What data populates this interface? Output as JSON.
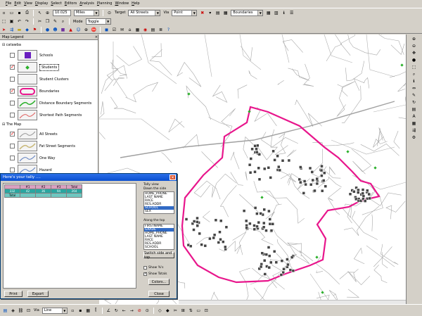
{
  "menu": [
    "File",
    "Edit",
    "View",
    "Display",
    "Select",
    "Editors",
    "Analysis",
    "Planning",
    "Window",
    "Help"
  ],
  "toolbar": {
    "scale_value": "10.025",
    "units": "Miles",
    "target_label": "Target",
    "target_value": "All Streets",
    "via_label": "Via",
    "via_value": "Point",
    "layer_value": "Boundaries",
    "mode_label": "Mode",
    "mode_value": "Toggle"
  },
  "legend": {
    "title": "Map Legend",
    "group1": "catawba",
    "items1": [
      {
        "label": "Schools",
        "checked": false
      },
      {
        "label": "Students",
        "checked": true
      },
      {
        "label": "Student Clusters",
        "checked": false
      },
      {
        "label": "Boundaries",
        "checked": true
      },
      {
        "label": "Distance Boundary Segments",
        "checked": false
      },
      {
        "label": "Shortest Path Segments",
        "checked": false
      }
    ],
    "group2": "The Map",
    "items2": [
      {
        "label": "All Streets",
        "checked": true
      },
      {
        "label": "Fat Street Segments",
        "checked": false
      },
      {
        "label": "One Way",
        "checked": false
      },
      {
        "label": "Hazard",
        "checked": false
      }
    ]
  },
  "dialog": {
    "title": "Here's your tally ....",
    "table_header": [
      "",
      "#1",
      "#2",
      "#3",
      "Total"
    ],
    "rows": [
      [
        "332",
        "42",
        "36",
        "94",
        "264"
      ],
      [
        "Total",
        "",
        "",
        "",
        ""
      ]
    ],
    "tally_view_label": "Tally view",
    "down_side_label": "Down the side",
    "down_side_items": [
      "HOME_PHONE",
      "LAST NAME",
      "RACE",
      "RES.ADDR",
      "SCHOOL",
      "SEX"
    ],
    "down_side_selected": 4,
    "along_top_label": "Along the top",
    "along_top_items": [
      "FIRSTNAME",
      "GRADE",
      "HOME_PHONE",
      "LAST NAME",
      "RACE",
      "RES.ADDR",
      "SCHOOL"
    ],
    "along_top_selected": 1,
    "switch_button": "Switch side and top",
    "show_percent": "Show %'s",
    "show_totals": "Show Totals",
    "colors_button": "Colors...",
    "close_button": "Close",
    "print_button": "Print",
    "export_button": "Export"
  },
  "status": {
    "via_label": "Via",
    "via_value": "Line"
  },
  "colors": {
    "boundary": "#e8168c",
    "student": "#444444",
    "school": "#2ab02a",
    "street": "#9a9a9a"
  }
}
